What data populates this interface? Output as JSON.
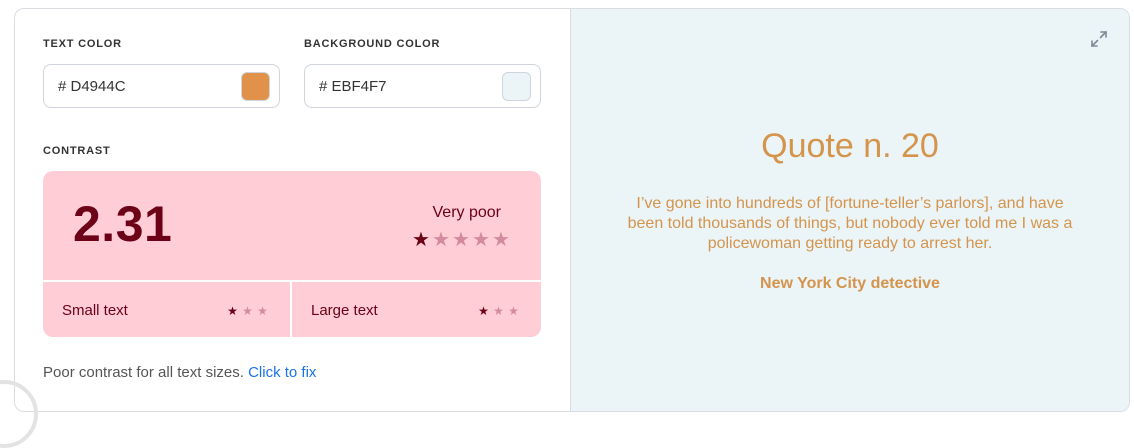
{
  "colors": {
    "text_color": "#D4944C",
    "background_color": "#EBF4F7",
    "contrast_bg": "#FFCDD6",
    "contrast_fg": "#6b0016",
    "link": "#1a73e8"
  },
  "text_color": {
    "label": "TEXT COLOR",
    "value": "# D4944C",
    "swatch_color": "#E0924A"
  },
  "background_color": {
    "label": "BACKGROUND COLOR",
    "value": "# EBF4F7",
    "swatch_color": "#EBF4F7"
  },
  "contrast": {
    "label": "CONTRAST",
    "ratio": "2.31",
    "rating": "Very poor",
    "rating_stars": 1,
    "rating_stars_max": 5,
    "small_text": {
      "label": "Small text",
      "stars": 1,
      "stars_max": 3
    },
    "large_text": {
      "label": "Large text",
      "stars": 1,
      "stars_max": 3
    }
  },
  "footer": {
    "message": "Poor contrast for all text sizes.",
    "link_label": "Click to fix"
  },
  "preview": {
    "expand_icon": "expand-icon",
    "title": "Quote n. 20",
    "body": "I’ve gone into hundreds of [fortune-teller’s parlors], and have been told thousands of things, but nobody ever told me I was a policewoman getting ready to arrest her.",
    "author": "New York City detective"
  }
}
